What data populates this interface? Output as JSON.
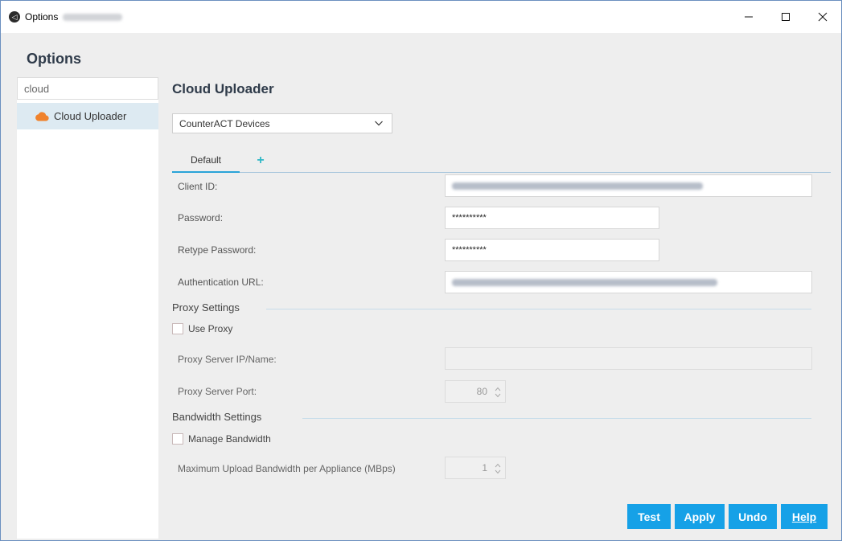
{
  "window": {
    "title": "Options",
    "controls": {
      "minimize": "—",
      "maximize": "☐",
      "close": "✕"
    }
  },
  "page_heading": "Options",
  "sidebar": {
    "search_value": "cloud",
    "items": [
      {
        "label": "Cloud Uploader",
        "icon": "cloud-icon",
        "selected": true
      }
    ]
  },
  "main": {
    "section_title": "Cloud Uploader",
    "dropdown_value": "CounterACT Devices",
    "tabs": [
      {
        "label": "Default",
        "active": true
      },
      {
        "label": "+",
        "active": false
      }
    ],
    "fields": {
      "client_id_label": "Client ID:",
      "password_label": "Password:",
      "password_value": "**********",
      "retype_password_label": "Retype Password:",
      "retype_password_value": "**********",
      "auth_url_label": "Authentication URL:"
    },
    "proxy": {
      "title": "Proxy Settings",
      "use_proxy_label": "Use Proxy",
      "use_proxy_checked": false,
      "server_label": "Proxy Server IP/Name:",
      "server_value": "",
      "port_label": "Proxy Server Port:",
      "port_value": "80"
    },
    "bandwidth": {
      "title": "Bandwidth Settings",
      "manage_label": "Manage Bandwidth",
      "manage_checked": false,
      "max_label": "Maximum Upload Bandwidth per Appliance (MBps)",
      "max_value": "1"
    }
  },
  "buttons": {
    "test": "Test",
    "apply": "Apply",
    "undo": "Undo",
    "help": "Help"
  },
  "colors": {
    "accent": "#16a1e7",
    "selection": "#ddeaf2",
    "cloud": "#f0822c",
    "plus": "#2fb7c6"
  }
}
